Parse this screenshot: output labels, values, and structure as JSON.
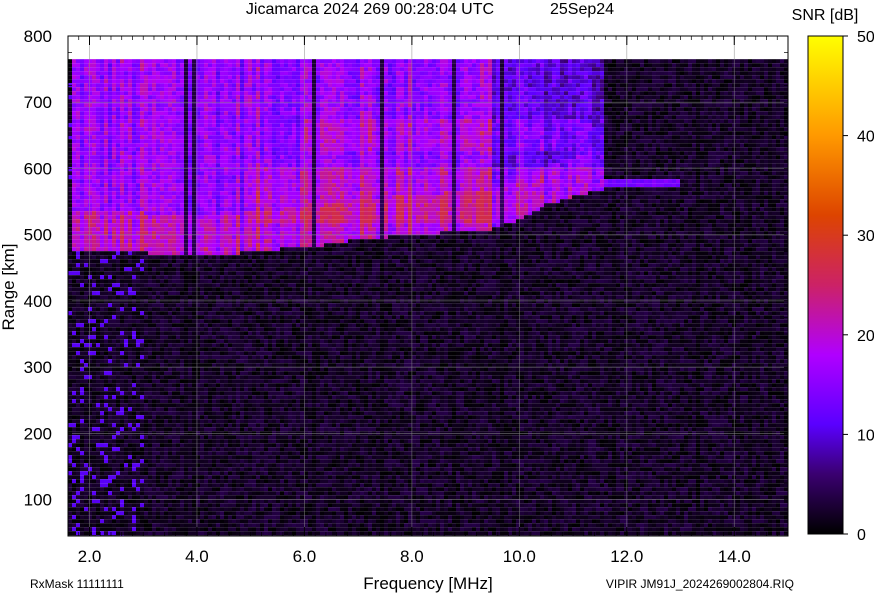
{
  "chart_data": {
    "type": "heatmap",
    "title": "Jicamarca 2024 269 00:28:04 UTC",
    "date_label": "25Sep24",
    "xlabel": "Frequency [MHz]",
    "ylabel": "Range [km]",
    "xlim": [
      1.6,
      15.0
    ],
    "ylim": [
      45,
      800
    ],
    "x_ticks": [
      "2.0",
      "4.0",
      "6.0",
      "8.0",
      "10.0",
      "12.0",
      "14.0"
    ],
    "x_tick_values": [
      2.0,
      4.0,
      6.0,
      8.0,
      10.0,
      12.0,
      14.0
    ],
    "y_ticks": [
      "100",
      "200",
      "300",
      "400",
      "500",
      "600",
      "700",
      "800"
    ],
    "y_tick_values": [
      100,
      200,
      300,
      400,
      500,
      600,
      700,
      800
    ],
    "colorbar": {
      "label": "SNR [dB]",
      "range": [
        0,
        50
      ],
      "ticks": [
        "0",
        "10",
        "20",
        "30",
        "40",
        "50"
      ],
      "tick_values": [
        0,
        10,
        20,
        30,
        40,
        50
      ]
    },
    "grid": true,
    "data_top_km": 765,
    "echo_trace": {
      "freq_mhz": [
        1.7,
        2.5,
        3.5,
        4.8,
        5.5,
        6.2,
        6.8,
        7.5,
        8.5,
        9.5,
        10.0,
        10.5,
        11.6
      ],
      "virtual_height_km": [
        478,
        475,
        470,
        472,
        478,
        482,
        490,
        496,
        502,
        508,
        522,
        545,
        570
      ]
    },
    "peak_snr_db": 27,
    "colors": {
      "colormap": [
        "#000000",
        "#3a0070",
        "#5a00ff",
        "#b000ff",
        "#cc2266",
        "#dd4400",
        "#ff9900",
        "#ffff00"
      ],
      "background": "#ffffff"
    }
  },
  "footer": {
    "left": "RxMask 11111111",
    "right": "VIPIR  JM91J_2024269002804.RIQ"
  }
}
